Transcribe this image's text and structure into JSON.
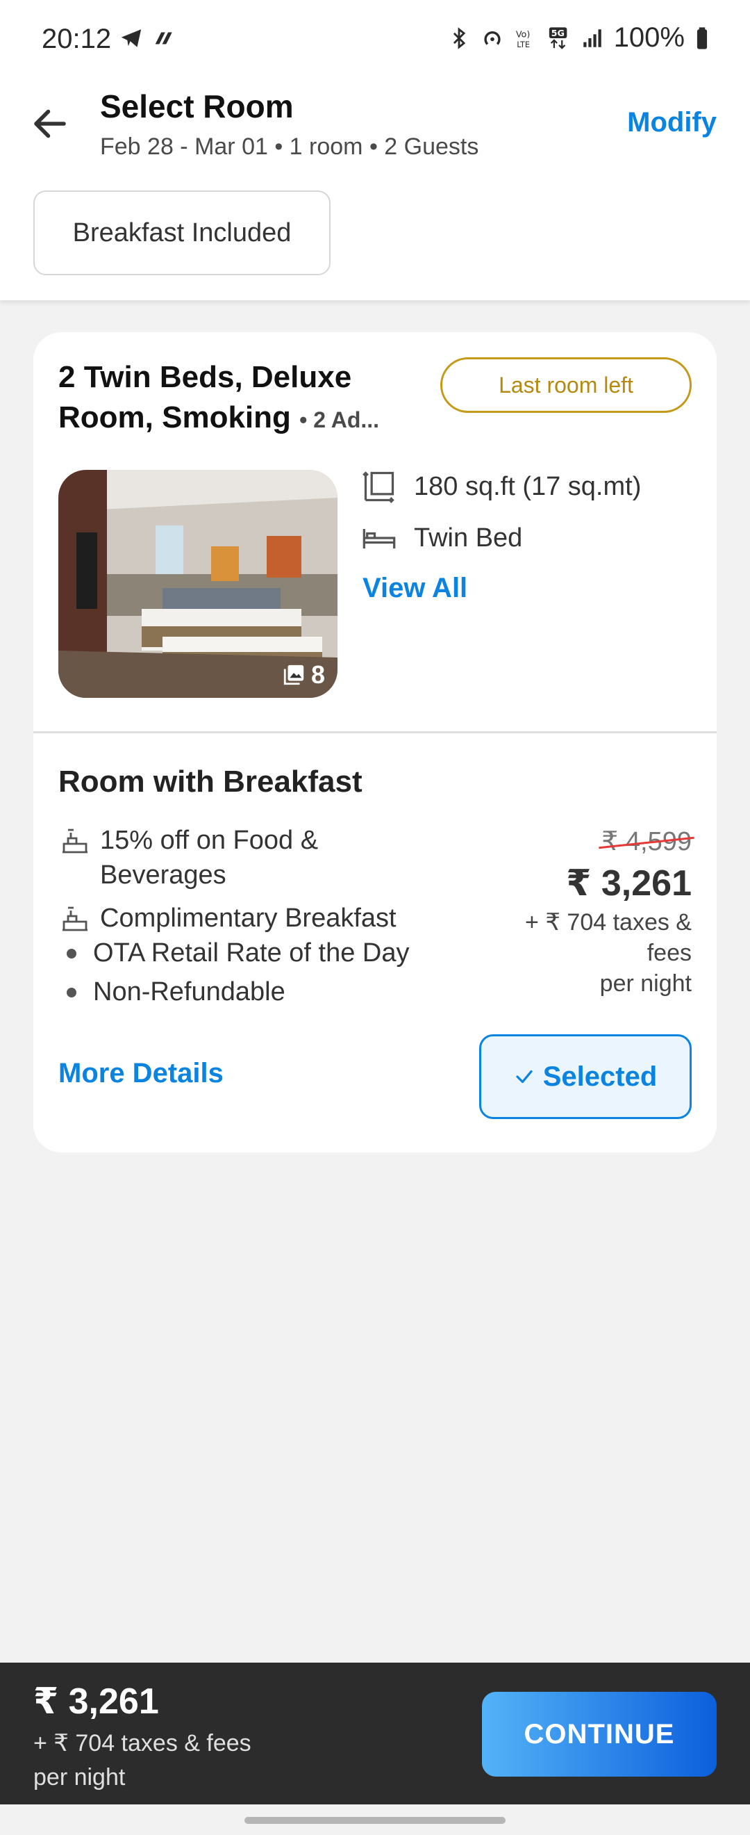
{
  "status_bar": {
    "time": "20:12",
    "battery": "100%",
    "icons": [
      "telegram-icon",
      "app-icon",
      "bluetooth-icon",
      "hotspot-icon",
      "volte-icon",
      "5g-icon",
      "signal-icon",
      "battery-icon"
    ]
  },
  "header": {
    "title": "Select Room",
    "subtitle": "Feb 28 - Mar 01 • 1 room • 2 Guests",
    "modify_label": "Modify"
  },
  "filters": {
    "chip_label": "Breakfast Included"
  },
  "room": {
    "title": "2 Twin Beds, Deluxe Room, Smoking",
    "occupancy": "• 2 Ad...",
    "badge": "Last room left",
    "photo_count": "8",
    "area": "180 sq.ft (17 sq.mt)",
    "bed": "Twin Bed",
    "view_all_label": "View All"
  },
  "plan": {
    "title": "Room with Breakfast",
    "inclusions": [
      "15% off on Food & Beverages",
      "Complimentary Breakfast"
    ],
    "bullets": [
      "OTA Retail Rate of the Day",
      "Non-Refundable"
    ],
    "old_price": "₹ 4,599",
    "price": "₹ 3,261",
    "taxes": "+ ₹ 704 taxes & fees",
    "per_night": "per night",
    "more_details_label": "More Details",
    "selected_label": "Selected"
  },
  "bottom_bar": {
    "price": "₹ 3,261",
    "taxes": "+ ₹ 704 taxes & fees",
    "per_night": "per night",
    "continue_label": "CONTINUE"
  },
  "colors": {
    "accent": "#0a84e0",
    "badge_gold": "#c49a1b",
    "strike_red": "#e53935",
    "bottom_bar": "#2c2c2c"
  }
}
